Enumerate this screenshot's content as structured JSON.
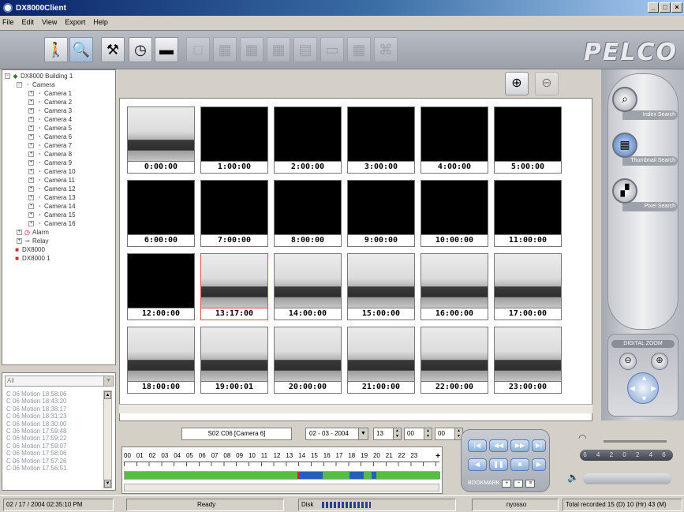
{
  "window": {
    "title": "DX8000Client",
    "btn_min": "_",
    "btn_max": "□",
    "btn_close": "×"
  },
  "menu": [
    "File",
    "Edit",
    "View",
    "Export",
    "Help"
  ],
  "brand": "PELCO",
  "tree": {
    "root": "DX8000 Building 1",
    "camera_group": "Camera",
    "cameras": [
      "Camera 1",
      "Camera 2",
      "Camera 3",
      "Camera 4",
      "Camera 5",
      "Camera 6",
      "Camera 7",
      "Camera 8",
      "Camera 9",
      "Camera 10",
      "Camera 11",
      "Camera 12",
      "Camera 13",
      "Camera 14",
      "Camera 15",
      "Camera 16"
    ],
    "alarm": "Alarm",
    "relay": "Relay",
    "servers": [
      "DX8000",
      "DX8000 1"
    ]
  },
  "events": {
    "filter": "All",
    "items": [
      "C 06 Motion 18:58:06",
      "C 06 Motion 18:43:20",
      "C 06 Motion 18:38:17",
      "C 06 Motion 18:31:23",
      "C 06 Motion 18:30:00",
      "C 06 Motion 17:59:48",
      "C 06 Motion 17:59:22",
      "C 06 Motion 17:59:07",
      "C 06 Motion 17:58:06",
      "C 06 Motion 17:57:26",
      "C 06 Motion 17:56:51"
    ]
  },
  "thumbnails": [
    {
      "time": "0:00:00",
      "recorded": true
    },
    {
      "time": "1:00:00",
      "recorded": false
    },
    {
      "time": "2:00:00",
      "recorded": false
    },
    {
      "time": "3:00:00",
      "recorded": false
    },
    {
      "time": "4:00:00",
      "recorded": false
    },
    {
      "time": "5:00:00",
      "recorded": false
    },
    {
      "time": "6:00:00",
      "recorded": false
    },
    {
      "time": "7:00:00",
      "recorded": false
    },
    {
      "time": "8:00:00",
      "recorded": false
    },
    {
      "time": "9:00:00",
      "recorded": false
    },
    {
      "time": "10:00:00",
      "recorded": false
    },
    {
      "time": "11:00:00",
      "recorded": false
    },
    {
      "time": "12:00:00",
      "recorded": false
    },
    {
      "time": "13:17:00",
      "recorded": true,
      "selected": true
    },
    {
      "time": "14:00:00",
      "recorded": true
    },
    {
      "time": "15:00:00",
      "recorded": true
    },
    {
      "time": "16:00:00",
      "recorded": true
    },
    {
      "time": "17:00:00",
      "recorded": true
    },
    {
      "time": "18:00:00",
      "recorded": true
    },
    {
      "time": "19:00:01",
      "recorded": true
    },
    {
      "time": "20:00:00",
      "recorded": true
    },
    {
      "time": "21:00:00",
      "recorded": true
    },
    {
      "time": "22:00:00",
      "recorded": true
    },
    {
      "time": "23:00:00",
      "recorded": true
    }
  ],
  "search_modes": {
    "index": "Index Search",
    "thumbnail": "Thumbnail Search",
    "pixel": "Pixel Search"
  },
  "digital_zoom": "DIGITAL ZOOM",
  "playback": {
    "camera_name": "S02 C06 [Camera 6]",
    "date": "02 - 03 - 2004",
    "hour": "13",
    "minute": "00",
    "second": "00",
    "hours": [
      "00",
      "01",
      "02",
      "03",
      "04",
      "05",
      "06",
      "07",
      "08",
      "09",
      "10",
      "11",
      "12",
      "13",
      "14",
      "15",
      "16",
      "17",
      "18",
      "19",
      "20",
      "21",
      "22",
      "23"
    ],
    "plus": "+",
    "bookmark": "BOOKMARK",
    "speed_scale": "6 4 2 0 2 4 6"
  },
  "status": {
    "datetime": "02 / 17 / 2004  02:35:10 PM",
    "state": "Ready",
    "disk_label": "Disk",
    "user": "nyosso",
    "total": "Total recorded 15 (D) 10 (Hr) 43 (M)"
  }
}
